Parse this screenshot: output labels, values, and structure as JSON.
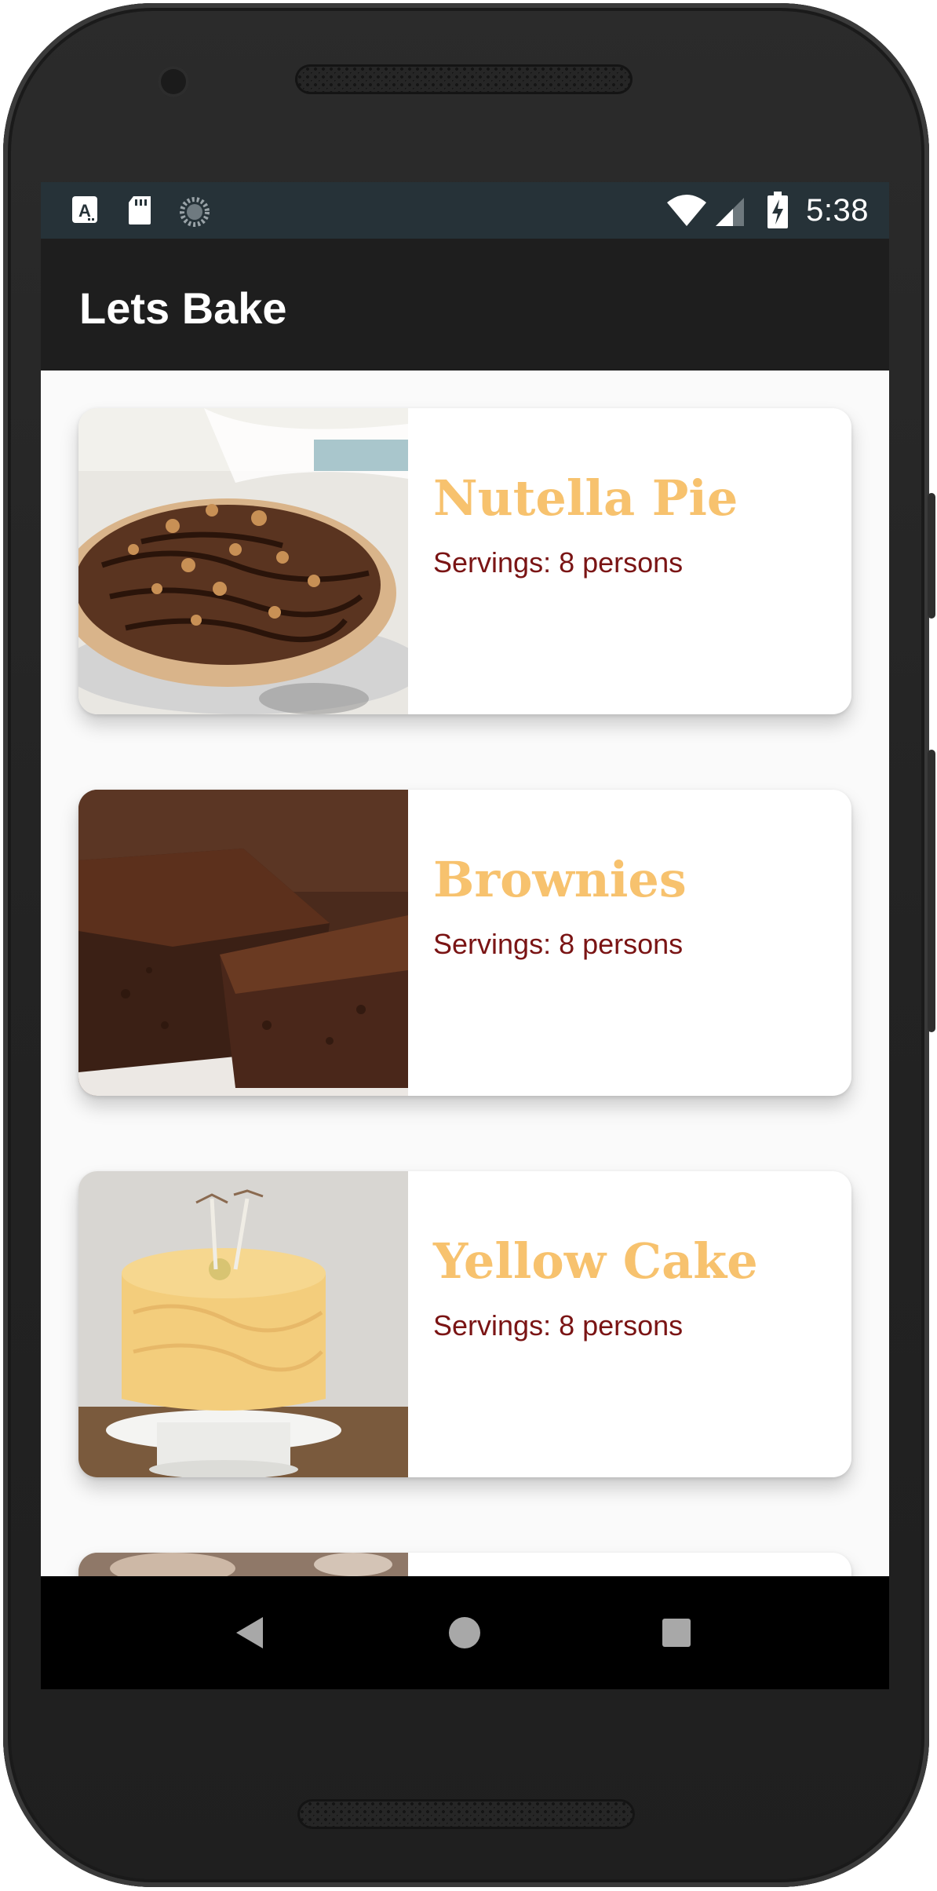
{
  "status_bar": {
    "time": "5:38",
    "left_icons": [
      "a-accessibility-icon",
      "sd-card-icon",
      "sync-spinner-icon"
    ],
    "right_icons": [
      "wifi-icon",
      "cell-signal-icon",
      "battery-charging-icon"
    ]
  },
  "app_bar": {
    "title": "Lets Bake"
  },
  "recipes": [
    {
      "name": "Nutella Pie",
      "servings": "Servings: 8 persons"
    },
    {
      "name": "Brownies",
      "servings": "Servings: 8 persons"
    },
    {
      "name": "Yellow Cake",
      "servings": "Servings: 8 persons"
    }
  ],
  "nav_bar": {
    "icons": [
      "back-icon",
      "home-icon",
      "recents-icon"
    ]
  },
  "colors": {
    "status_bar": "#263238",
    "app_bar": "#1e1e1e",
    "title_accent": "#f7c26e",
    "servings_text": "#7a1414"
  }
}
